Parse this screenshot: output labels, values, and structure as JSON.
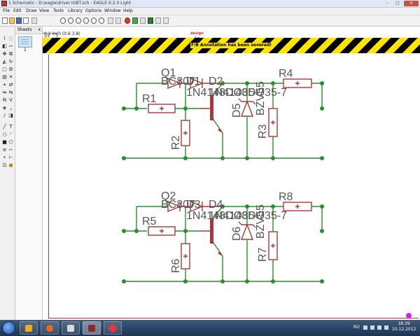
{
  "window": {
    "title": "1 Schematic - D:\\eagle\\driver IGBT.sch - EAGLE 6.2.0 Light",
    "minimize": "–",
    "maximize": "□",
    "close": "✕"
  },
  "menu": [
    "File",
    "Edit",
    "Draw",
    "View",
    "Tools",
    "Library",
    "Options",
    "Window",
    "Help"
  ],
  "toolbar": {
    "sheet_select": "1/1",
    "logo_line1": "design",
    "logo_line2": "link"
  },
  "sheets_panel": {
    "header": "Sheets",
    "close": "x",
    "sheet_number": "1"
  },
  "status": {
    "grid_coords": "0.1 inch (0.6 3.8)"
  },
  "banner": {
    "message": "F/B Annotation has been severed!"
  },
  "schematic": {
    "circuits": [
      {
        "q_label": "Q1",
        "q_value": "BC807",
        "d1_label": "D1",
        "d1_value": "1N4148DO35-7",
        "d2_label": "D2",
        "d2_value": "1N4148DO35-7",
        "r1_label": "R1",
        "r2_label": "R2",
        "r3_label": "R3",
        "r4_label": "R4",
        "d5_label": "D5",
        "zener_value": "BZV55"
      },
      {
        "q_label": "Q2",
        "q_value": "BC807",
        "d1_label": "D3",
        "d1_value": "1N4148DO35-7",
        "d2_label": "D4",
        "d2_value": "1N4148DO35-7",
        "r1_label": "R5",
        "r2_label": "R6",
        "r3_label": "R7",
        "r4_label": "R8",
        "d5_label": "D6",
        "zener_value": "BZV55"
      }
    ]
  },
  "taskbar": {
    "language": "RO",
    "time": "18:39",
    "date": "10.12.2012"
  },
  "colors": {
    "wire": "#2e8b2e",
    "symbol": "#a23a3a",
    "text": "#555555",
    "hazard_yellow": "#ffe500"
  }
}
